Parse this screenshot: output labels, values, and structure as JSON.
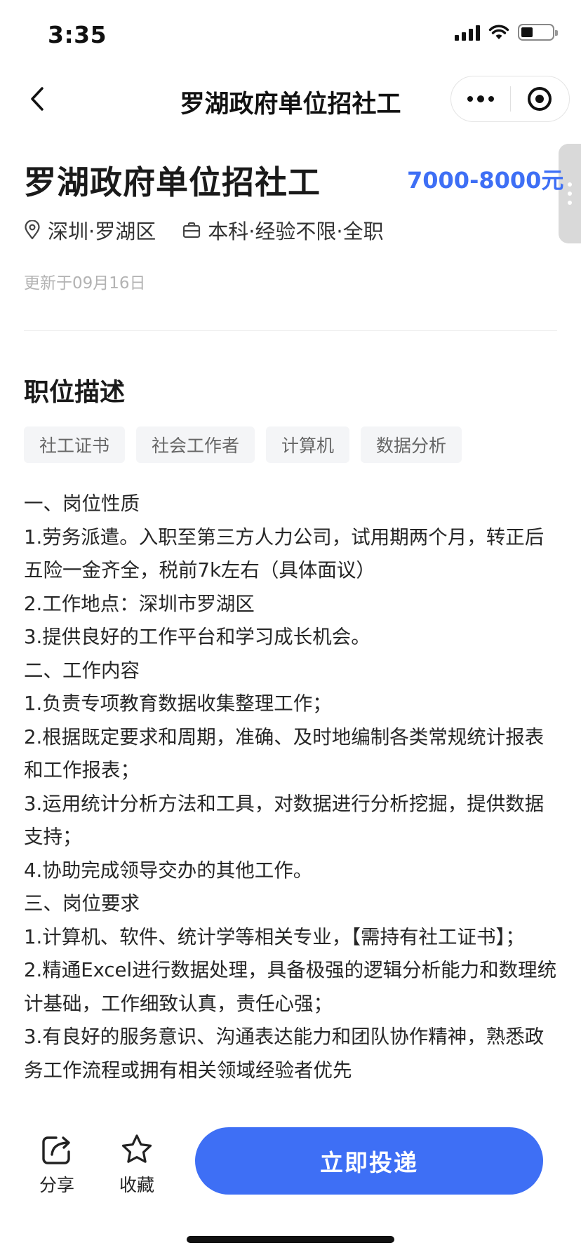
{
  "status_bar": {
    "time": "3:35"
  },
  "nav": {
    "title": "罗湖政府单位招社工"
  },
  "job": {
    "title": "罗湖政府单位招社工",
    "salary": "7000-8000元",
    "location": "深圳·罗湖区",
    "requirements": "本科·经验不限·全职",
    "updated": "更新于09月16日"
  },
  "description": {
    "section_title": "职位描述",
    "tags": [
      "社工证书",
      "社会工作者",
      "计算机",
      "数据分析"
    ],
    "lines": [
      "一、岗位性质",
      "1.劳务派遣。入职至第三方人力公司，试用期两个月，转正后五险一金齐全，税前7k左右（具体面议）",
      "2.工作地点：深圳市罗湖区",
      "3.提供良好的工作平台和学习成长机会。",
      "二、工作内容",
      "1.负责专项教育数据收集整理工作；",
      "2.根据既定要求和周期，准确、及时地编制各类常规统计报表和工作报表；",
      "3.运用统计分析方法和工具，对数据进行分析挖掘，提供数据支持；",
      "4.协助完成领导交办的其他工作。",
      "三、岗位要求",
      "1.计算机、软件、统计学等相关专业，【需持有社工证书】；",
      "2.精通Excel进行数据处理，具备极强的逻辑分析能力和数理统计基础，工作细致认真，责任心强；",
      "3.有良好的服务意识、沟通表达能力和团队协作精神，熟悉政务工作流程或拥有相关领域经验者优先"
    ]
  },
  "bottom": {
    "share_label": "分享",
    "favorite_label": "收藏",
    "apply_label": "立即投递"
  },
  "colors": {
    "accent": "#3e6ff5",
    "muted": "#b3b3b3",
    "tag_bg": "#f4f5f7"
  },
  "icons": [
    "back-arrow-icon",
    "more-dots-icon",
    "target-icon",
    "location-pin-icon",
    "briefcase-icon",
    "share-icon",
    "star-icon"
  ]
}
